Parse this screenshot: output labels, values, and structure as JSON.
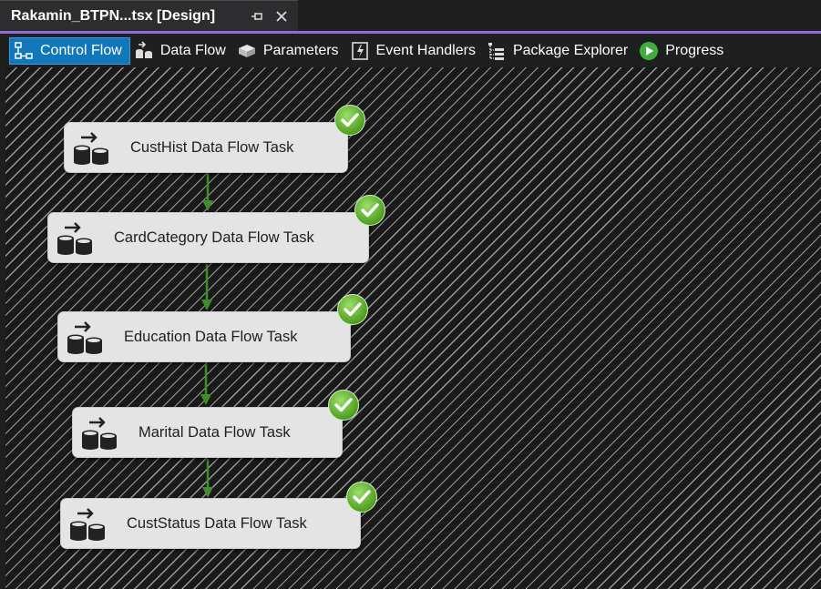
{
  "document_tab": {
    "title": "Rakamin_BTPN...tsx [Design]"
  },
  "toolbar": {
    "items": [
      {
        "label": "Control Flow",
        "icon": "control-flow-icon",
        "active": true
      },
      {
        "label": "Data Flow",
        "icon": "data-flow-icon",
        "active": false
      },
      {
        "label": "Parameters",
        "icon": "parameters-icon",
        "active": false
      },
      {
        "label": "Event Handlers",
        "icon": "event-handlers-icon",
        "active": false
      },
      {
        "label": "Package Explorer",
        "icon": "package-explorer-icon",
        "active": false
      },
      {
        "label": "Progress",
        "icon": "progress-play-icon",
        "active": false
      }
    ]
  },
  "tasks": [
    {
      "label": "CustHist Data Flow Task",
      "status": "success"
    },
    {
      "label": "CardCategory Data Flow Task",
      "status": "success"
    },
    {
      "label": "Education Data Flow Task",
      "status": "success"
    },
    {
      "label": "Marital Data Flow Task",
      "status": "success"
    },
    {
      "label": "CustStatus Data Flow Task",
      "status": "success"
    }
  ],
  "colors": {
    "accent": "#8e6bd8",
    "active_tab": "#1177bb",
    "success": "#5aa82b",
    "connector": "#3e8f2a"
  }
}
